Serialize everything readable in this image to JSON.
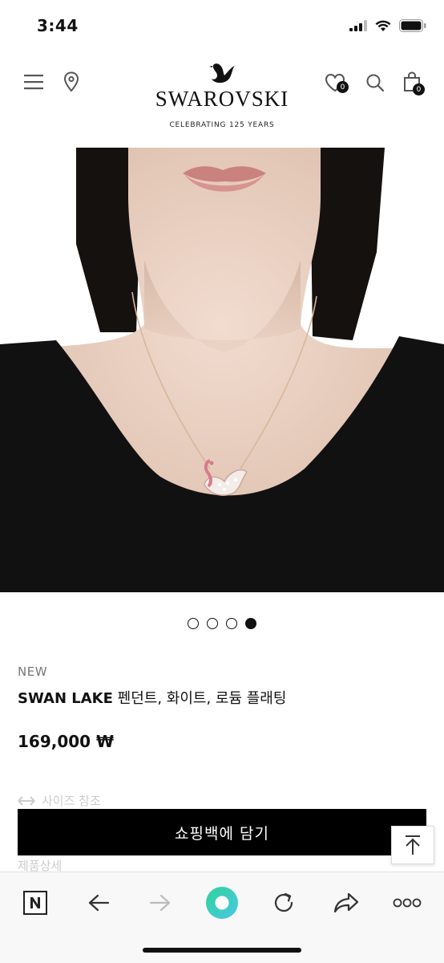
{
  "status_bar": {
    "time": "3:44"
  },
  "header": {
    "brand": "SWAROVSKI",
    "tagline": "CELEBRATING 125 YEARS",
    "wishlist_count": "0",
    "bag_count": "0",
    "icons": [
      "menu-icon",
      "location-pin-icon",
      "heart-icon",
      "search-icon",
      "shopping-bag-icon"
    ]
  },
  "hero": {
    "carousel_total": 4,
    "carousel_active": 4
  },
  "product": {
    "badge": "NEW",
    "name_bold": "SWAN LAKE",
    "name_rest": " 펜던트, 화이트, 로듐 플래팅",
    "price": "169,000 ₩",
    "size_guide": "사이즈 참조",
    "detail_label": "제품상세",
    "add_to_bag": "쇼핑백에 담기"
  },
  "browser_toolbar": {
    "icons": [
      "naver-n-icon",
      "back-arrow-icon",
      "forward-arrow-icon",
      "green-orb-icon",
      "refresh-icon",
      "share-icon",
      "more-icon"
    ]
  },
  "colors": {
    "accent_green": "#3ed08c",
    "button_black": "#000000",
    "hero_bg": "#e8e2dc"
  }
}
